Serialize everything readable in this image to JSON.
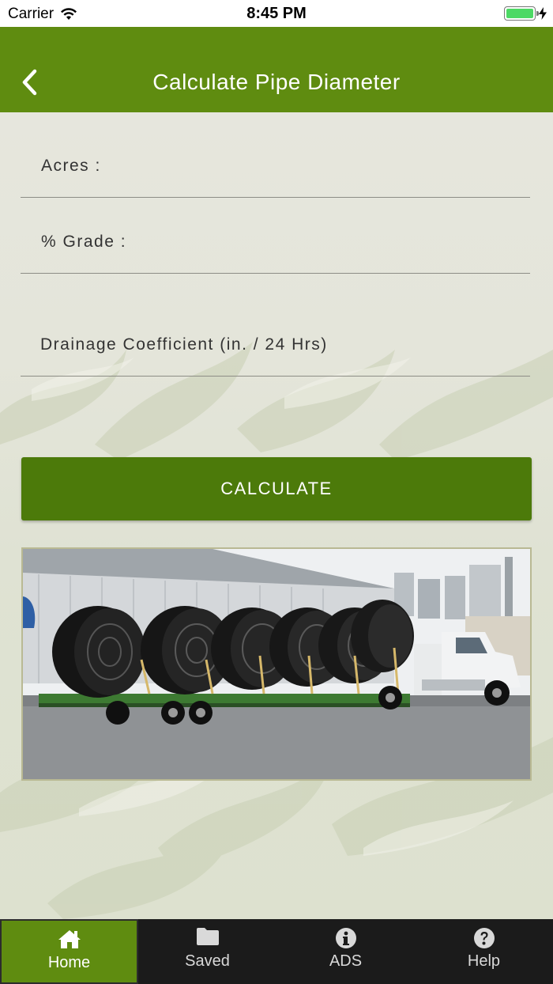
{
  "status": {
    "carrier": "Carrier",
    "time": "8:45 PM"
  },
  "header": {
    "title": "Calculate Pipe Diameter"
  },
  "form": {
    "acres_label": "Acres :",
    "grade_label": "% Grade :",
    "drainage_label": "Drainage Coefficient (in. / 24 Hrs)",
    "calculate_label": "CALCULATE"
  },
  "tabs": [
    {
      "label": "Home",
      "icon": "home-icon"
    },
    {
      "label": "Saved",
      "icon": "folder-icon"
    },
    {
      "label": "ADS",
      "icon": "info-icon"
    },
    {
      "label": "Help",
      "icon": "help-icon"
    }
  ],
  "colors": {
    "brand_green": "#5f8c10",
    "button_green": "#4c7a0a",
    "tab_bar": "#1b1b1b"
  }
}
